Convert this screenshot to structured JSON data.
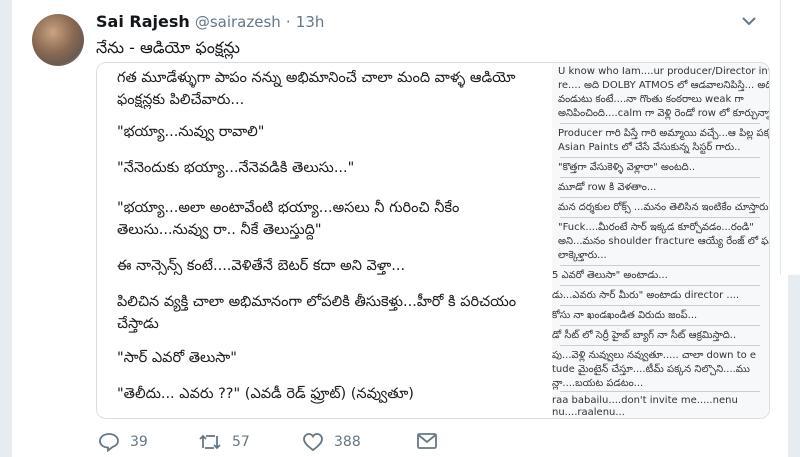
{
  "tweet": {
    "author_name": "Sai Rajesh",
    "author_handle": "@sairazesh",
    "separator": "·",
    "time": "13h",
    "text": "నేను - ఆడియో ఫంక్షన్లు"
  },
  "image_left": {
    "paragraphs": [
      "గత మూడేళ్ళుగా పాపం నన్ను అభిమానించే చాలా మంది వాళ్ళ ఆడియో ఫంక్షన్లకు పిలిచేవారు...",
      "\"భయ్యా...నువ్వు రావాలి\"",
      "\"నేనెందుకు భయ్యా...నేనెవడికి తెలుసు...\"",
      "\"భయ్యా...అలా అంటావేంటి భయ్యా...అసలు నీ గురించి నీకేం తెలుసు...నువ్వు రా.. నీకే తెలుస్తుద్ది\"",
      "ఈ నాన్సెన్స్ కంటే....వెళితేనే బెటర్ కదా అని వెళ్తా...",
      "పిలిచిన వ్యక్తి చాలా అభిమానంగా లోపలికి తీసుకెళ్తు...హీరో కి పరిచయం చేస్తాడు",
      "\"సార్ ఎవరో తెలుసా\"",
      "\"తెలీదు... ఎవరు ??\" (ఎవడీ రెడ్ ఫ్రూట్) (నవ్వుతూ)"
    ]
  },
  "image_right": {
    "lines": [
      "U know who Iam....ur producer/Director invited me",
      "re.... అది DOLBY ATMOS లో ఆడవాలనిపిస్తి... అది",
      "వండుటు కంటే....నా గొంతు కంఠరాలు weak గా",
      "అనిపించింది....calm గా వెళ్లి రెండో row లో కూర్చున్నా",
      "Producer గారి పిస్తే గారి అమ్మాయి వచ్చే...ఆ పిల్ల పక్కన",
      "Asian Paints లో చేసే వేసుకున్న సిస్టర్ గారు..",
      "\"కొత్తగా వేసుకెళ్ళి వెళ్లారా\" అంటది..",
      "మూడో row కి వెళతాం...",
      "మన దర్శకుల రోక్స్ ...మనం తెలిసిన ఇంటికేం చూస్తారు.",
      "\"Fuck....మీరంటే సార్ ఇక్కడ కూర్చోవడం...రండి\"",
      "అని...మనం shoulder fracture ఆయ్యే రేంజ్ లో ఫస్ట్ row కి",
      "లాక్కెళ్తారు...",
      "5 ఎవరో తెలుసా\" అంటాడు...",
      "డు...ఎవరు సార్ మీరు\" అంటాడు director ....",
      "కోసు నా ఖండఖండిత విరుదు జంప్...",
      "డో సీట్ లో సెర్రీ హైబ్ బ్యాగ్ నా సీట్ ఆక్రమిస్తాది..",
      "పు...వెళ్లి నువ్వులు నవ్వుతూ..... చాలా down to e",
      "tude మైంటైన్ చేస్తూ....టీమ్ పక్కన నిల్చొని....ము",
      "న్లా....బయట పడటం...",
      "raa babailu....don't invite me.....nenu",
      "nu....raalenu..."
    ]
  },
  "actions": {
    "replies": "39",
    "retweets": "57",
    "likes": "388"
  },
  "colors": {
    "text": "#14171a",
    "secondary": "#657786",
    "background": "#e6ecf0"
  },
  "icons": [
    "chevron-down-icon",
    "reply-icon",
    "retweet-icon",
    "like-icon",
    "message-icon"
  ]
}
